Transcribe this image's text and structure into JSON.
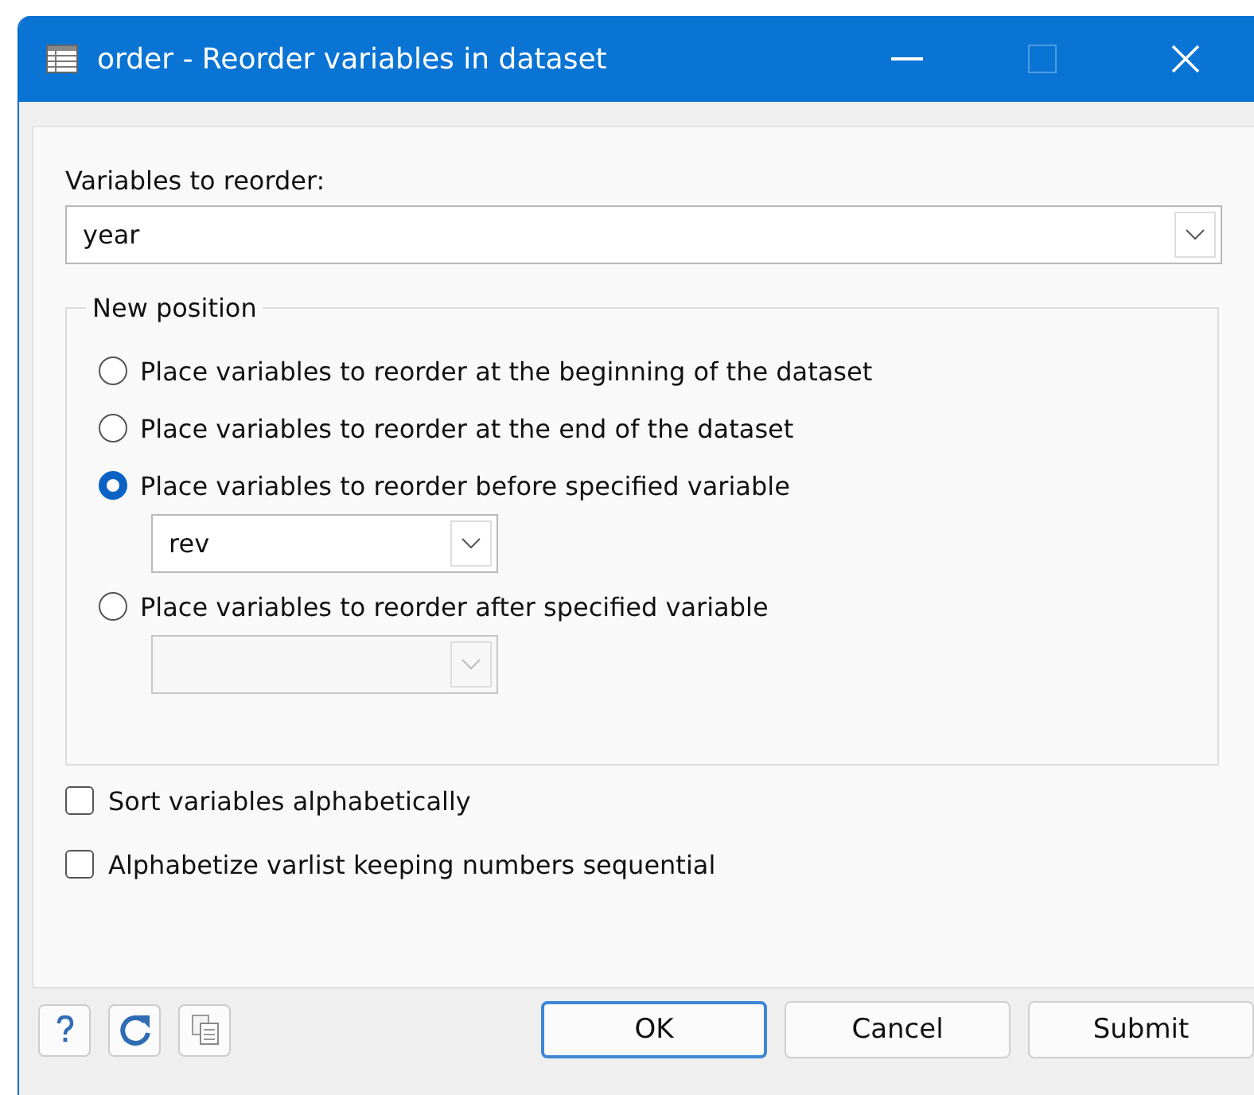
{
  "window": {
    "title": "order - Reorder variables in dataset"
  },
  "variables": {
    "label": "Variables to reorder:",
    "value": "year"
  },
  "new_position": {
    "title": "New position",
    "options": [
      {
        "label": "Place variables to reorder at the beginning of the dataset",
        "selected": false
      },
      {
        "label": "Place variables to reorder at the end of the dataset",
        "selected": false
      },
      {
        "label": "Place variables to reorder before specified variable",
        "selected": true,
        "combo": {
          "value": "rev",
          "disabled": false
        }
      },
      {
        "label": "Place variables to reorder after specified variable",
        "selected": false,
        "combo": {
          "disabled": true
        }
      }
    ]
  },
  "checkboxes": [
    {
      "label": "Sort variables alphabetically",
      "checked": false
    },
    {
      "label": "Alphabetize varlist keeping numbers sequential",
      "checked": false
    }
  ],
  "buttons": [
    {
      "label": "OK",
      "default": true
    },
    {
      "label": "Cancel",
      "default": false
    },
    {
      "label": "Submit",
      "default": false
    }
  ]
}
